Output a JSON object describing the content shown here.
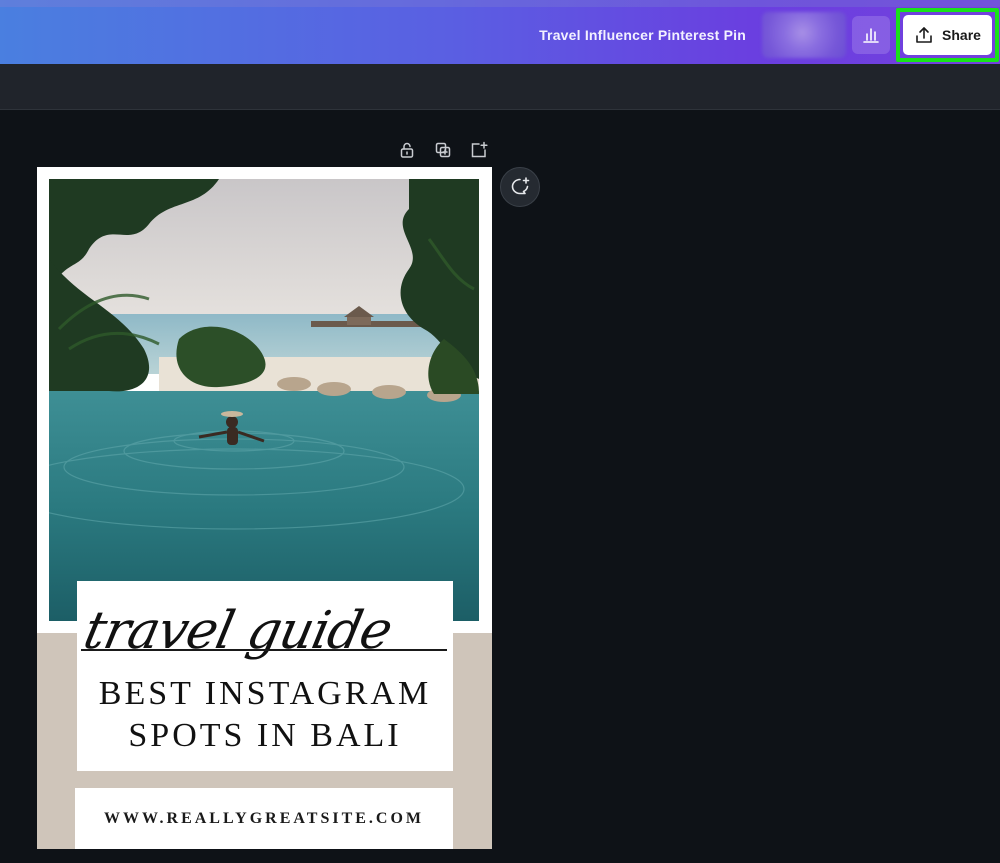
{
  "header": {
    "document_title": "Travel Influencer Pinterest Pin",
    "share_label": "Share"
  },
  "design": {
    "script_title": "travel guide",
    "headline_line1": "BEST INSTAGRAM",
    "headline_line2": "SPOTS IN BALI",
    "website": "WWW.REALLYGREATSITE.COM"
  },
  "colors": {
    "share_highlight": "#19e21a",
    "canvas_background": "#0e1217",
    "beige_band": "#cfc5ba"
  },
  "icons": {
    "analytics": "bar-chart-icon",
    "share": "upload-icon",
    "lock": "lock-icon",
    "duplicate": "duplicate-page-icon",
    "add_page": "add-page-icon",
    "comment": "add-comment-icon"
  }
}
